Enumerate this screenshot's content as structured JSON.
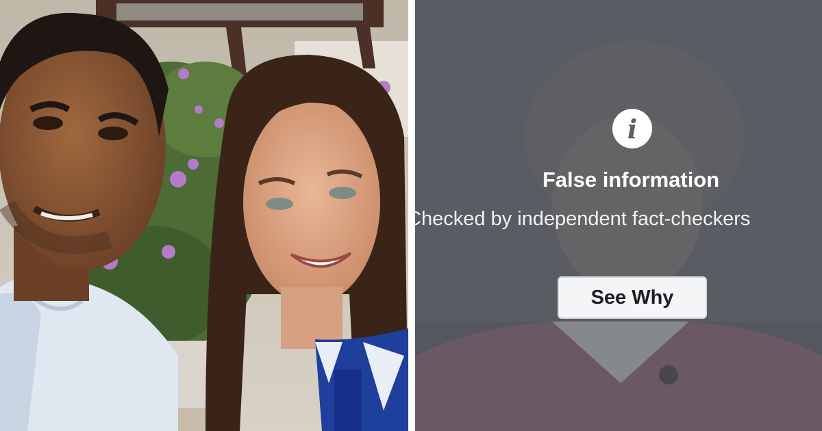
{
  "left_photo": {
    "image": "couple-selfie-photo"
  },
  "fact_check_overlay": {
    "icon": "info-icon",
    "icon_glyph": "i",
    "title": "False information",
    "subtitle": "Checked by independent fact-checkers",
    "button_label": "See Why",
    "colors": {
      "overlay": "#5d6066",
      "text": "#ffffff",
      "button_bg": "#f4f5f7",
      "button_text": "#1c1e21"
    }
  }
}
